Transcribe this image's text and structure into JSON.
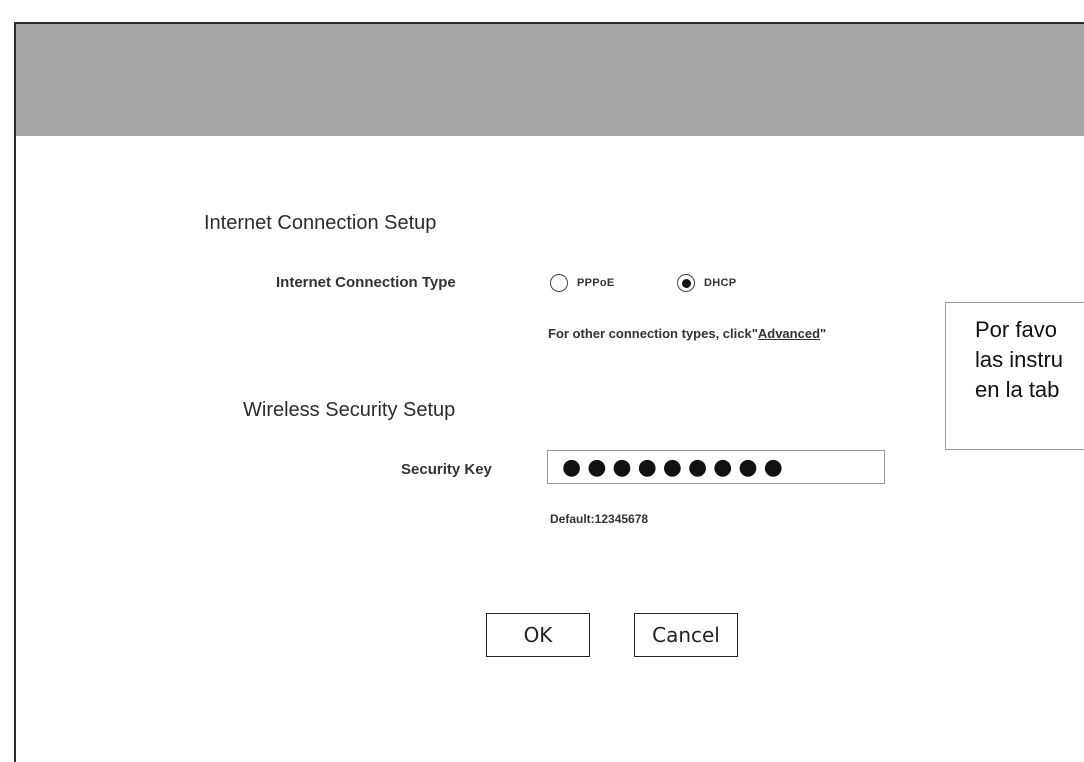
{
  "internet_setup": {
    "title": "Internet Connection Setup",
    "type_label": "Internet Connection Type",
    "options": [
      {
        "label": "PPPoE",
        "selected": false
      },
      {
        "label": "DHCP",
        "selected": true
      }
    ],
    "hint_prefix": "For other connection types, click\"",
    "hint_link": "Advanced",
    "hint_suffix": "\""
  },
  "wireless_setup": {
    "title": "Wireless Security Setup",
    "key_label": "Security Key",
    "key_value": "●●●●●●●●●",
    "default_note": "Default:12345678"
  },
  "buttons": {
    "ok": "OK",
    "cancel": "Cancel"
  },
  "note_box": {
    "lines": [
      "Por favo",
      "las instru",
      "en la tab"
    ]
  }
}
